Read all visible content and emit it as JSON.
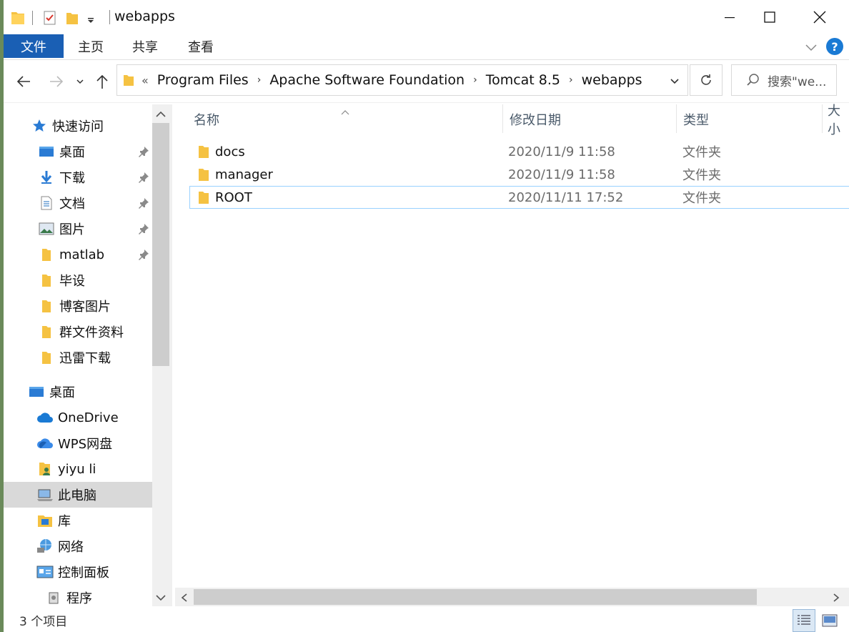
{
  "window": {
    "title": "webapps"
  },
  "ribbon": {
    "tabs": [
      "文件",
      "主页",
      "共享",
      "查看"
    ]
  },
  "address": {
    "overflow": "«",
    "crumbs": [
      "Program Files",
      "Apache Software Foundation",
      "Tomcat 8.5",
      "webapps"
    ]
  },
  "search": {
    "placeholder": "搜索\"we..."
  },
  "nav": {
    "quick_access": "快速访问",
    "pinned": [
      "桌面",
      "下载",
      "文档",
      "图片",
      "matlab"
    ],
    "recent": [
      "毕设",
      "博客图片",
      "群文件资料",
      "迅雷下载"
    ],
    "desktop": "桌面",
    "onedrive": "OneDrive",
    "wps": "WPS网盘",
    "user": "yiyu li",
    "this_pc": "此电脑",
    "library": "库",
    "network": "网络",
    "control_panel": "控制面板",
    "programs": "程序"
  },
  "columns": {
    "name": "名称",
    "modified": "修改日期",
    "type": "类型",
    "size": "大小"
  },
  "files": [
    {
      "name": "docs",
      "modified": "2020/11/9 11:58",
      "type": "文件夹"
    },
    {
      "name": "manager",
      "modified": "2020/11/9 11:58",
      "type": "文件夹"
    },
    {
      "name": "ROOT",
      "modified": "2020/11/11 17:52",
      "type": "文件夹"
    }
  ],
  "status": {
    "count": "3 个项目"
  },
  "colors": {
    "accent": "#1a5fb4",
    "folder": "#f5c242",
    "selected": "#d9d9d9",
    "focus_border": "#99d1ff"
  }
}
